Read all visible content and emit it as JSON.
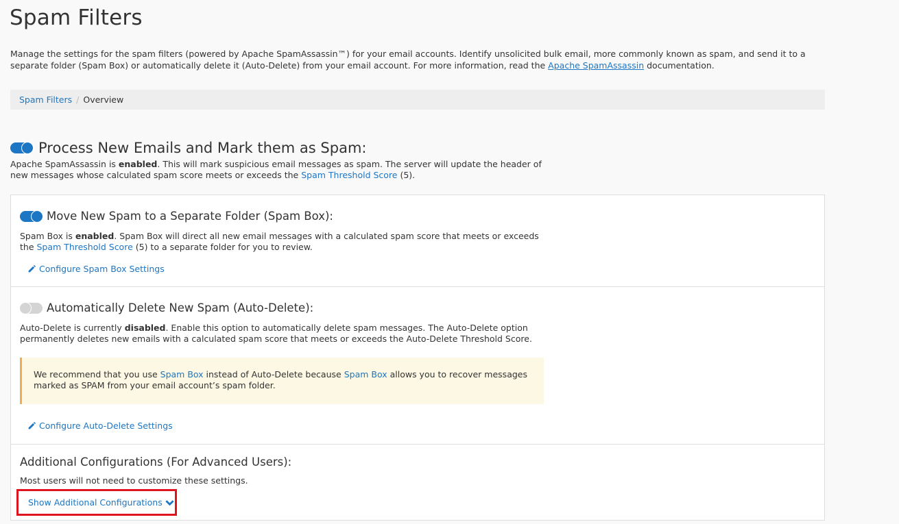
{
  "page": {
    "title": "Spam Filters",
    "intro_before_link": "Manage the settings for the spam filters (powered by Apache SpamAssassin™) for your email accounts. Identify unsolicited bulk email, more commonly known as spam, and send it to a separate folder (Spam Box) or automatically delete it (Auto-Delete) from your email account. For more information, read the ",
    "intro_link": "Apache SpamAssassin",
    "intro_after_link": " documentation."
  },
  "breadcrumb": {
    "root": "Spam Filters",
    "separator": "/",
    "current": "Overview"
  },
  "process": {
    "title": "Process New Emails and Mark them as Spam:",
    "enabled": true,
    "desc_1": "Apache SpamAssassin is ",
    "desc_bold": "enabled",
    "desc_2": ". This will mark suspicious email messages as spam. The server will update the header of new messages whose calculated spam score meets or exceeds the ",
    "desc_link": "Spam Threshold Score",
    "desc_3": " (5)."
  },
  "spam_box": {
    "title": "Move New Spam to a Separate Folder (Spam Box):",
    "enabled": true,
    "desc_1": "Spam Box is ",
    "desc_bold": "enabled",
    "desc_2": ". Spam Box will direct all new email messages with a calculated spam score that meets or exceeds the ",
    "desc_link": "Spam Threshold Score",
    "desc_3": " (5) to a separate folder for you to review.",
    "configure_link": "Configure Spam Box Settings"
  },
  "auto_delete": {
    "title": "Automatically Delete New Spam (Auto-Delete):",
    "enabled": false,
    "desc_1": "Auto-Delete is currently ",
    "desc_bold": "disabled",
    "desc_2": ". Enable this option to automatically delete spam messages. The Auto-Delete option permanently deletes new emails with a calculated spam score that meets or exceeds the Auto-Delete Threshold Score.",
    "alert_1": "We recommend that you use ",
    "alert_link_1": "Spam Box",
    "alert_2": " instead of Auto-Delete because ",
    "alert_link_2": "Spam Box",
    "alert_3": " allows you to recover messages marked as SPAM from your email account’s spam folder.",
    "configure_link": "Configure Auto-Delete Settings"
  },
  "advanced": {
    "title": "Additional Configurations (For Advanced Users):",
    "desc": "Most users will not need to customize these settings.",
    "show_button": "Show Additional Configurations"
  },
  "colors": {
    "accent": "#1c76c4",
    "highlight_border": "#e0141e",
    "alert_bg": "#fcf8e3",
    "alert_border": "#f0ad4e"
  },
  "icons": {
    "pencil": "pencil-icon",
    "chevron": "chevron-down-icon"
  }
}
